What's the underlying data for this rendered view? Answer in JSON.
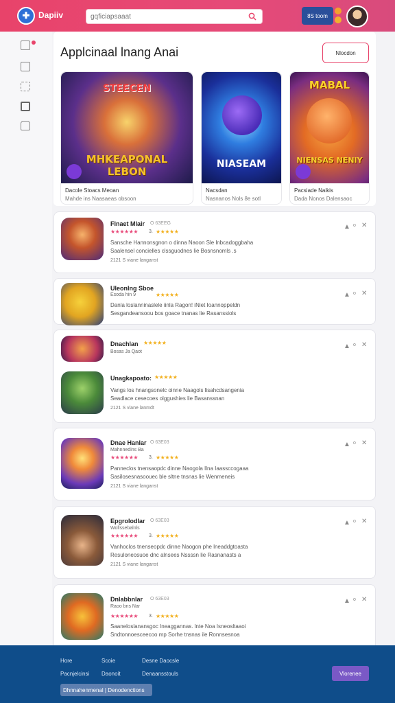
{
  "header": {
    "brand": "Dapiiv",
    "search_placeholder": "gqficiapsaaat",
    "button_label": "8S toom"
  },
  "main": {
    "title": "Applcinaal lnang Anai",
    "sort_label": "Nlocdon"
  },
  "featured": [
    {
      "art_top": "STEECEN",
      "art_bottom": "MHKEAPONAL LEBON",
      "line1": "Dacole Stoacs Meoan",
      "line2": "Mahde ins Naasaeas obsoon"
    },
    {
      "art_top": "",
      "art_bottom": "NIASEAM",
      "line1": "Nacsdan",
      "line2": "Nasnanos Nols 8e sotl"
    },
    {
      "art_top": "MABAL",
      "art_bottom": "NIENSAS NENIY",
      "line1": "Pacsiade Naikis",
      "line2": "Dada Nonos Dalensaoc"
    }
  ],
  "list": [
    {
      "name": "Flnaet Mlair",
      "tag": "O 63EEG",
      "sub": "",
      "rating": "3.",
      "desc1": "Sansche Hannonsgnon o dinna Naoon Sle lnbcadoggbaha",
      "desc2": "Saalensel concielles clssguodnes lie Bosnsnomls .s",
      "meta": "2121 S viane langanst"
    },
    {
      "name": "Uleonlng Sboe",
      "tag": "",
      "sub": "Esoda hin 9",
      "rating": "",
      "desc1": "Danla loslanninaslele iinla Ragon! iNiet Ioannoppeldn",
      "desc2": "Sesgandeansoou bos goace tnanas lie Rasanssiols",
      "meta": ""
    },
    {
      "name": "Dnachlan",
      "tag": "",
      "sub": "Bosas Ja Qaot",
      "rating": "",
      "desc1": "",
      "desc2": "",
      "meta": ""
    },
    {
      "name": "Unagkapoato:",
      "tag": "",
      "sub": "",
      "rating": "",
      "desc1": "Vangs los hnangsonelc oinne Naagols lisahcdsangenia",
      "desc2": "Seadlace cesecoes olggushies lie Basanssnan",
      "meta": "2121 S viane lanmdt"
    },
    {
      "name": "Dnae Hanlar",
      "tag": "O 63E03",
      "sub": "Mahnnedins Ba",
      "rating": "3.",
      "desc1": "Panneclos tnensaopdc dinne Naogola Ilna Iaassccogaaa",
      "desc2": "Sasilosesnasoouec ble sltne tnsnas lie Wenmeneis",
      "meta": "2121 S viane langanst"
    },
    {
      "name": "Epgrolodlar",
      "tag": "O 63E03",
      "sub": "Wollssebalnls",
      "rating": "3.",
      "desc1": "Vanhoclos tnenseopdc dinne Naogon phe lneaddgtoasta",
      "desc2": "Resuloneosuoe dnc alnsees Nssssn lie Rasnanasts a",
      "meta": "2121 S viane langanst"
    },
    {
      "name": "Dnlabbnlar",
      "tag": "O 63E03",
      "sub": "Raoo bns Nar",
      "rating": "3.",
      "desc1": "Saaneloslanansgoc Ineaggannas. lnte Noa Isneosltaaoi",
      "desc2": "Sndtonnoesceecoo mp Sorhe tnsnas ile Ronnsesnoa",
      "meta": ""
    }
  ],
  "footer": {
    "links": [
      "Hore",
      "Scoie",
      "Desne Daocsle",
      "Pacnjelcinsi",
      "Daonoit",
      "Denaansstouls"
    ],
    "button": "Vlorenee",
    "bar_label": "Dhnnahenmenal | Denodenctions"
  },
  "colors": {
    "accent": "#e8436a",
    "footer": "#0f4d8a",
    "star": "#f2b01e",
    "rating_pink": "#e84a7a"
  }
}
